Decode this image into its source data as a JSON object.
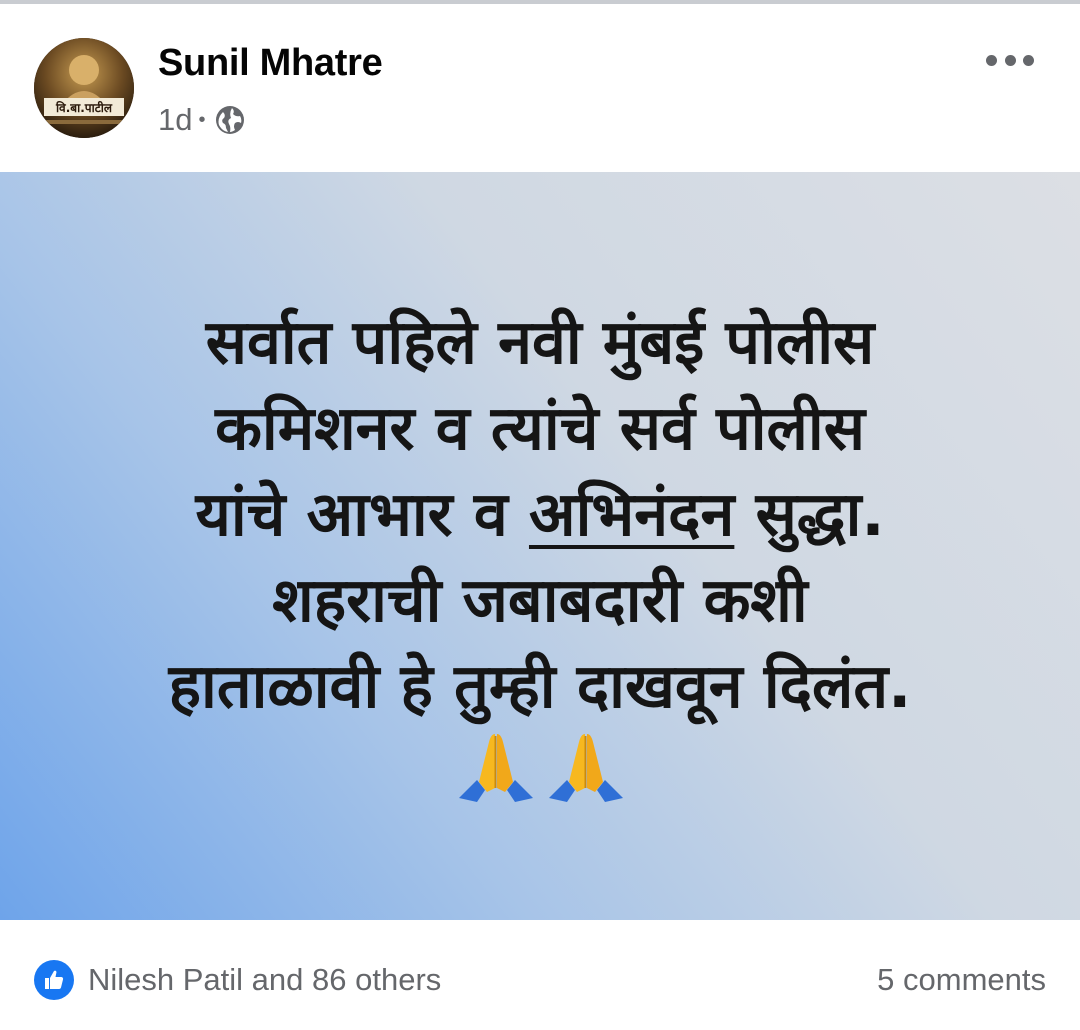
{
  "post": {
    "author": "Sunil Mhatre",
    "time": "1d",
    "separator": "•",
    "privacy_icon": "globe-icon",
    "menu_icon": "more-options-icon",
    "avatar": {
      "icon": "profile-photo",
      "caption": "वि.बा.पाटील"
    },
    "background_colors": [
      "#6ea4ea",
      "#a7c4e8",
      "#dcdfe4"
    ],
    "message_lines": [
      "सर्वात पहिले नवी मुंबई पोलीस",
      "कमिशनर व त्यांचे सर्व पोलीस",
      {
        "before": "यांचे आभार व ",
        "underlined": "अभिनंदन",
        "after": " सुद्धा."
      },
      "शहराची जबाबदारी कशी",
      "हाताळावी हे तुम्ही दाखवून दिलंत."
    ],
    "emoji": [
      "🙏",
      "🙏"
    ]
  },
  "footer": {
    "reaction_icon": "like-icon",
    "reaction_color": "#1877f2",
    "reactors": "Nilesh Patil and 86 others",
    "comments": "5 comments"
  }
}
